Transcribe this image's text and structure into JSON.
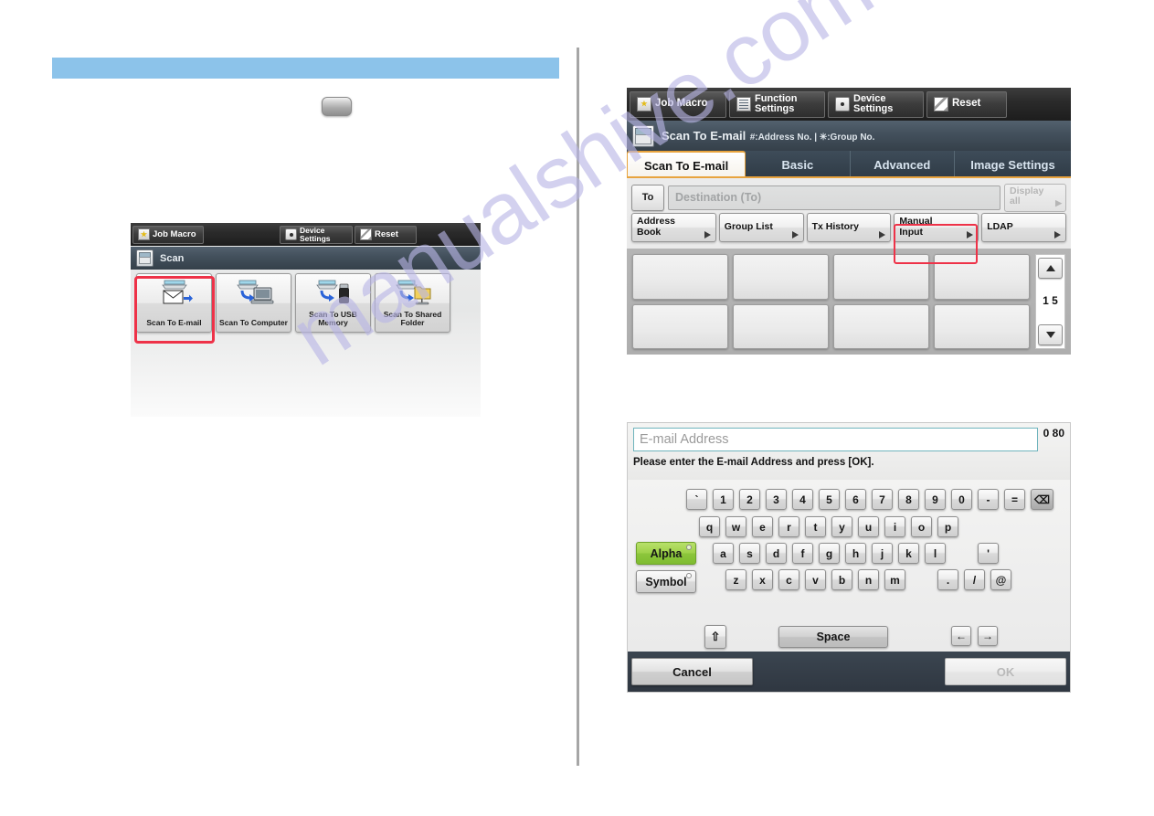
{
  "watermark": "manualshive.com",
  "scan_home": {
    "toolbar": [
      {
        "label": "Job Macro",
        "icon": "star-icon",
        "two_line": false
      },
      {
        "label": "Device Settings",
        "line1": "Device",
        "line2": "Settings",
        "icon": "device-icon",
        "two_line": true
      },
      {
        "label": "Reset",
        "icon": "reset-icon",
        "two_line": false
      }
    ],
    "header_title": "Scan",
    "tiles": [
      {
        "label_line1": "Scan To E-mail",
        "label_line2": "",
        "icon": "scan-to-email-icon",
        "selected": true
      },
      {
        "label_line1": "Scan To Computer",
        "label_line2": "",
        "icon": "scan-to-computer-icon",
        "selected": false
      },
      {
        "label_line1": "Scan To USB",
        "label_line2": "Memory",
        "icon": "scan-to-usb-icon",
        "selected": false
      },
      {
        "label_line1": "Scan To Shared",
        "label_line2": "Folder",
        "icon": "scan-to-folder-icon",
        "selected": false
      }
    ]
  },
  "email_screen": {
    "toolbar": [
      {
        "label": "Job Macro",
        "line1": "Job Macro",
        "line2": "",
        "icon": "star-icon",
        "two_line": false
      },
      {
        "label": "Function Settings",
        "line1": "Function",
        "line2": "Settings",
        "icon": "list-icon",
        "two_line": true
      },
      {
        "label": "Device Settings",
        "line1": "Device",
        "line2": "Settings",
        "icon": "device-icon",
        "two_line": true
      },
      {
        "label": "Reset",
        "line1": "Reset",
        "line2": "",
        "icon": "reset-icon",
        "two_line": false
      }
    ],
    "header": {
      "title": "Scan To E-mail",
      "subtitle": "#:Address No. | ✳:Group No.",
      "icon": "scan-to-email-icon"
    },
    "tabs": [
      {
        "label": "Scan To E-mail",
        "active": true
      },
      {
        "label": "Basic",
        "active": false
      },
      {
        "label": "Advanced",
        "active": false
      },
      {
        "label": "Image Settings",
        "active": false
      }
    ],
    "destination": {
      "to_label": "To",
      "placeholder": "Destination (To)",
      "display_all_line1": "Display",
      "display_all_line2": "all"
    },
    "sources": [
      {
        "line1": "Address",
        "line2": "Book",
        "highlighted": false
      },
      {
        "line1": "Group List",
        "line2": "",
        "highlighted": false
      },
      {
        "line1": "Tx History",
        "line2": "",
        "highlighted": false
      },
      {
        "line1": "Manual",
        "line2": "Input",
        "highlighted": true
      },
      {
        "line1": "LDAP",
        "line2": "",
        "highlighted": false
      }
    ],
    "pager": {
      "current": "1",
      "total": "5",
      "up_icon": "chevron-up-icon",
      "down_icon": "chevron-down-icon"
    },
    "address_cells": [
      "",
      "",
      "",
      "",
      "",
      "",
      "",
      ""
    ]
  },
  "keyboard_screen": {
    "input_placeholder": "E-mail Address",
    "input_value": "",
    "counter_current": "0",
    "counter_max": "80",
    "prompt": "Please enter the E-mail Address and press [OK].",
    "row_number": [
      "`",
      "1",
      "2",
      "3",
      "4",
      "5",
      "6",
      "7",
      "8",
      "9",
      "0",
      "-",
      "="
    ],
    "backspace_icon": "backspace-icon",
    "row_top": [
      "q",
      "w",
      "e",
      "r",
      "t",
      "y",
      "u",
      "i",
      "o",
      "p"
    ],
    "row_home": [
      "a",
      "s",
      "d",
      "f",
      "g",
      "h",
      "j",
      "k",
      "l"
    ],
    "row_home_extra": "'",
    "row_bottom": [
      "z",
      "x",
      "c",
      "v",
      "b",
      "n",
      "m"
    ],
    "row_bottom_extra": [
      ".",
      "/",
      "@"
    ],
    "mode_alpha": "Alpha",
    "mode_symbol": "Symbol",
    "shift_icon": "shift-icon",
    "space_label": "Space",
    "arrow_left_icon": "arrow-left-icon",
    "arrow_right_icon": "arrow-right-icon",
    "cancel_label": "Cancel",
    "ok_label": "OK"
  },
  "colors": {
    "accent_blue_bar": "#8cc3ea",
    "highlight_red": "#ee3248",
    "tab_orange": "#e8a33d",
    "alpha_green": "#8cc63c",
    "header_slate": "#44515d"
  }
}
